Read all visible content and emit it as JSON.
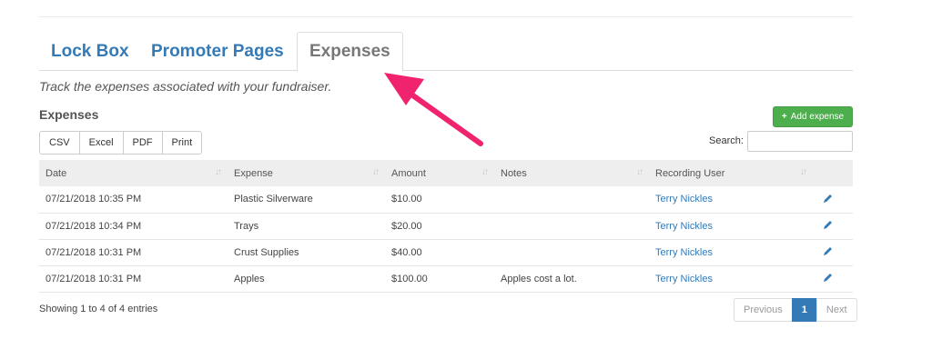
{
  "tabs": [
    {
      "label": "Lock Box"
    },
    {
      "label": "Promoter Pages"
    },
    {
      "label": "Expenses"
    }
  ],
  "description": "Track the expenses associated with your fundraiser.",
  "section_title": "Expenses",
  "add_button": {
    "label": "Add expense",
    "icon": "plus-icon"
  },
  "export_buttons": [
    "CSV",
    "Excel",
    "PDF",
    "Print"
  ],
  "search": {
    "label": "Search:",
    "value": ""
  },
  "table": {
    "headers": [
      "Date",
      "Expense",
      "Amount",
      "Notes",
      "Recording User"
    ],
    "rows": [
      {
        "date": "07/21/2018 10:35 PM",
        "expense": "Plastic Silverware",
        "amount": "$10.00",
        "notes": "",
        "user": "Terry Nickles"
      },
      {
        "date": "07/21/2018 10:34 PM",
        "expense": "Trays",
        "amount": "$20.00",
        "notes": "",
        "user": "Terry Nickles"
      },
      {
        "date": "07/21/2018 10:31 PM",
        "expense": "Crust Supplies",
        "amount": "$40.00",
        "notes": "",
        "user": "Terry Nickles"
      },
      {
        "date": "07/21/2018 10:31 PM",
        "expense": "Apples",
        "amount": "$100.00",
        "notes": "Apples cost a lot.",
        "user": "Terry Nickles"
      }
    ]
  },
  "entries_info": "Showing 1 to 4 of 4 entries",
  "pagination": {
    "previous": "Previous",
    "current": "1",
    "next": "Next"
  },
  "colors": {
    "link": "#337ab7",
    "success": "#4cae4c",
    "annotation_arrow": "#f0246e"
  }
}
